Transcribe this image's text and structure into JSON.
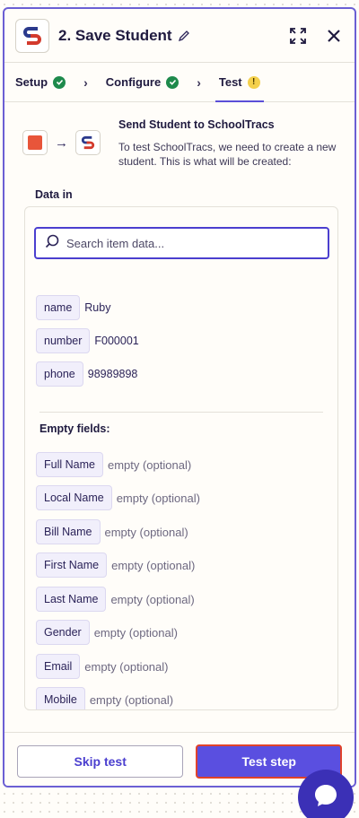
{
  "header": {
    "title": "2. Save Student",
    "logo_icon": "schooltracs-logo-icon",
    "expand_icon": "expand-icon",
    "close_icon": "close-icon"
  },
  "tabs": [
    {
      "label": "Setup",
      "status": "complete"
    },
    {
      "label": "Configure",
      "status": "complete"
    },
    {
      "label": "Test",
      "status": "warning",
      "warning_glyph": "!"
    }
  ],
  "step": {
    "title": "Send Student to SchoolTracs",
    "description": "To test SchoolTracs, we need to create a new student. This is what will be created:"
  },
  "data_tab": {
    "label": "Data in"
  },
  "search": {
    "placeholder": "Search item data..."
  },
  "fields": [
    {
      "name": "name",
      "value": "Ruby"
    },
    {
      "name": "number",
      "value": "F000001"
    },
    {
      "name": "phone",
      "value": "98989898"
    }
  ],
  "empty_fields": {
    "title": "Empty fields:",
    "empty_label": "empty (optional)",
    "items": [
      "Full Name",
      "Local Name",
      "Bill Name",
      "First Name",
      "Last Name",
      "Gender",
      "Email",
      "Mobile"
    ]
  },
  "footer": {
    "skip_label": "Skip test",
    "test_label": "Test step"
  },
  "colors": {
    "accent": "#5a4fe0",
    "success": "#1e8a4c",
    "warning": "#f4d04c",
    "highlight_border": "#e0422a"
  }
}
